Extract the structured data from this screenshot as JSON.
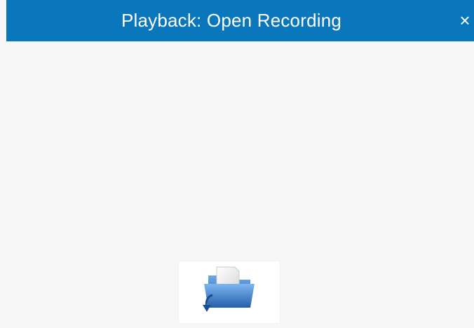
{
  "dialog": {
    "title": "Playback: Open Recording",
    "close_glyph": "×"
  },
  "actions": {
    "open_icon": "open-folder-icon"
  },
  "colors": {
    "titlebar": "#0a77bd",
    "background": "#f7f7f7",
    "tile": "#ffffff"
  }
}
